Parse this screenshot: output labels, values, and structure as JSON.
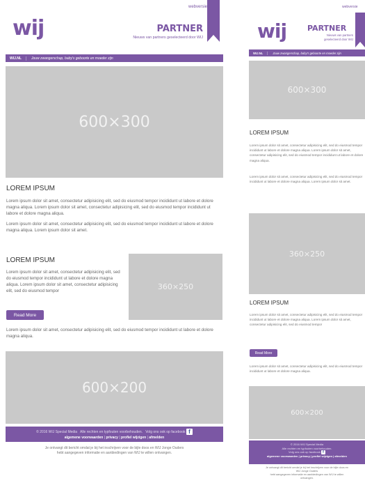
{
  "header": {
    "webversion_link": "webversie",
    "logo_text": "wij",
    "brand_title": "PARTNER",
    "brand_subtitle": "Nieuws van partners geselecteerd door WIJ",
    "brand_subtitle_mobile_1": "Nieuws van partners",
    "brand_subtitle_mobile_2": "geselecteerd door WIJ"
  },
  "nav": {
    "home_link": "WIJ.NL",
    "tagline": "Jouw zwangerschap, baby's geboorte en moeder zijn"
  },
  "desktop": {
    "hero_placeholder": "600×300",
    "section1": {
      "title": "LOREM IPSUM",
      "para1": "Lorem ipsum dolor sit amet, consectetur adipisicing elit, sed do eiusmod tempor incididunt ut labore et dolore magna aliqua. Lorem ipsum dolor sit amet, consectetur adipisicing elit, sed do eiusmod tempor incididunt ut labore et dolore magna aliqua.",
      "para2": "Lorem ipsum dolor sit amet, consectetur adipisicing elit, sed do eiusmod tempor incididunt ut labore et dolore magna aliqua. Lorem ipsum dolor sit amet."
    },
    "section2": {
      "title": "LOREM IPSUM",
      "para1": "Lorem ipsum dolor sit amet, consectetur adipisicing elit, sed do eiusmod tempor incididunt ut labore et dolore magna aliqua. Lorem ipsum dolor sit amet, consectetur adipisicing elit, sed do eiusmod tempor",
      "side_placeholder": "360×250",
      "button_label": "Read More",
      "para2": "Lorem ipsum dolor sit amet, consectetur adipisicing elit, sed do eiusmod tempor incididunt ut labore et dolore magna aliqua."
    },
    "banner_placeholder": "600×200"
  },
  "mobile": {
    "hero_placeholder": "600×300",
    "section1": {
      "title": "LOREM IPSUM",
      "para1": "Lorem ipsum dolor sit amet, consectetur adipisicing elit, sed do eiusmod tempor incididunt ut labore et dolore magna aliqua. Lorem ipsum dolor sit amet, consectetur adipisicing elit, sed do eiusmod tempor incididunt ut labore et dolore magna aliqua.",
      "para2": "Lorem ipsum dolor sit amet, consectetur adipisicing elit, sed do eiusmod tempor incididunt ut labore et dolore magna aliqua. Lorem ipsum dolor sit amet."
    },
    "side_placeholder": "360×250",
    "section2": {
      "title": "LOREM IPSUM",
      "para1": "Lorem ipsum dolor sit amet, consectetur adipisicing elit, sed do eiusmod tempor incididunt ut labore et dolore magna aliqua. Lorem ipsum dolor sit amet, consectetur adipisicing elit, sed do eiusmod tempor",
      "button_label": "Read More",
      "para2": "Lorem ipsum dolor sit amet, consectetur adipisicing elit, sed do eiusmod tempor incididunt ut labore et dolore magna aliqua."
    },
    "banner_placeholder": "600×200",
    "footer": {
      "line1": "© 2016 WIJ Special Media",
      "line2": "Alle rechten en typfouten voorbehouden.",
      "line3": "Volg ons ook op facebook",
      "links": "algemene voorwaarden | privacy | profiel wijzigen | afmelden"
    },
    "legal": {
      "line1": "Je ontvangt dit bericht omdat je bij het inschrijven voor de bijle doos en",
      "line2": "WIJ Jonge Ouders",
      "line3": "hebt aangegeven informatie en aanbiedingen van WIJ te willen",
      "line4": "ontvangen."
    }
  },
  "footer": {
    "copyright": "© 2016 WIJ Special Media",
    "rights": "Alle rechten en typfouten voorbehouden.",
    "facebook": "Volg ons ook op facebook",
    "link_terms": "algemene voorwaarden",
    "link_privacy": "privacy",
    "link_profile": "profiel wijzigen",
    "link_unsubscribe": "afmelden",
    "separator": "|"
  },
  "legal": {
    "line1": "Je ontvangt dit bericht omdat je bij het inschrijven voor de bijle doos en WIJ Jonge Ouders",
    "line2": "hebt aangegeven informatie en aanbiedingen van WIJ te willen ontvangen."
  },
  "colors": {
    "brand_purple": "#7b57a4",
    "placeholder_gray": "#c9c9c9",
    "background": "#ffffff"
  },
  "icons": {
    "facebook": "facebook-icon",
    "bookmark_ribbon": "ribbon-icon"
  }
}
